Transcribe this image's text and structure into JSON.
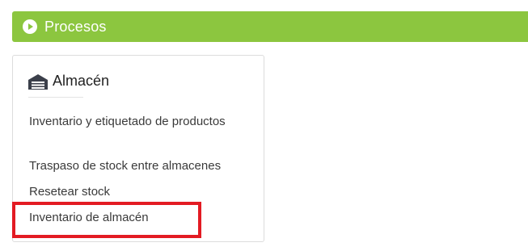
{
  "banner": {
    "title": "Procesos",
    "icon": "play-circle-icon",
    "color": "#8cc63f"
  },
  "card": {
    "title": "Almacén",
    "icon": "warehouse-icon",
    "links": [
      "Inventario y etiquetado de productos",
      "Traspaso de stock entre almacenes",
      "Resetear stock",
      "Inventario de almacén"
    ]
  },
  "highlight": {
    "target": "Inventario de almacén",
    "color": "#e31b23"
  }
}
